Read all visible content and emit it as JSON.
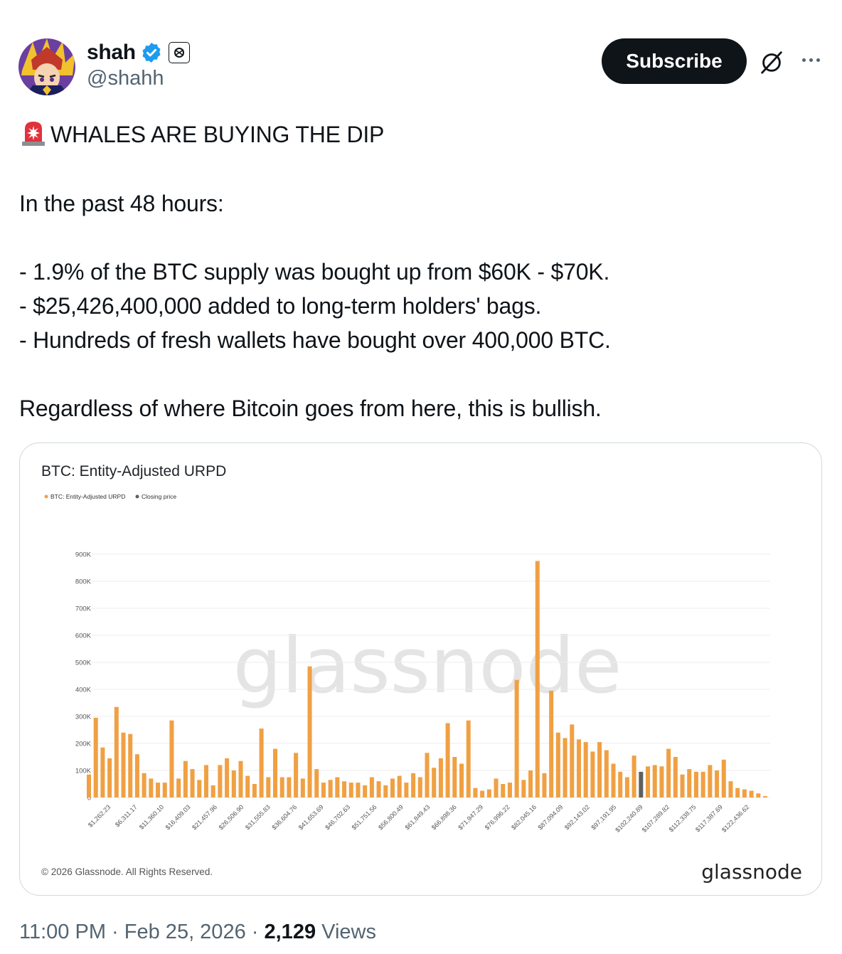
{
  "user": {
    "display_name": "shah",
    "handle": "@shahh"
  },
  "actions": {
    "subscribe_label": "Subscribe"
  },
  "post": {
    "headline": "WHALES ARE BUYING THE DIP",
    "intro": "In the past 48 hours:",
    "bullets": [
      "- 1.9% of the BTC supply was bought up from $60K - $70K.",
      "- $25,426,400,000 added to long-term holders' bags.",
      "- Hundreds of fresh wallets have bought over 400,000 BTC."
    ],
    "closing": "Regardless of where Bitcoin goes from here, this is bullish."
  },
  "meta": {
    "time": "11:00 PM",
    "date": "Feb 25, 2026",
    "views_count": "2,129",
    "views_label": "Views",
    "separator": "·"
  },
  "colors": {
    "bar": "#f0a043",
    "highlight_bar": "#5f5f5f",
    "closing_price_dot": "#5f5f5f",
    "accent_verified": "#1d9bf0"
  },
  "chart_data": {
    "type": "bar",
    "title": "BTC: Entity-Adjusted URPD",
    "legend": [
      {
        "name": "BTC: Entity-Adjusted URPD",
        "color": "#f0a043"
      },
      {
        "name": "Closing price",
        "color": "#5f5f5f"
      }
    ],
    "legend_position": "top-left",
    "watermark": "glassnode",
    "copyright": "© 2026 Glassnode. All Rights Reserved.",
    "brand": "glassnode",
    "grid": true,
    "ylim": [
      0,
      900000
    ],
    "y_ticks": [
      "0",
      "100K",
      "200K",
      "300K",
      "400K",
      "500K",
      "600K",
      "700K",
      "800K",
      "900K"
    ],
    "x_tick_labels": [
      "$1,262.23",
      "$6,311.17",
      "$11,360.10",
      "$16,409.03",
      "$21,457.96",
      "$26,506.90",
      "$31,555.83",
      "$36,604.76",
      "$41,653.69",
      "$46,702.63",
      "$51,751.56",
      "$56,800.49",
      "$61,849.43",
      "$66,898.36",
      "$71,947.29",
      "$76,996.22",
      "$82,045.16",
      "$87,094.09",
      "$92,143.02",
      "$97,191.95",
      "$102,240.89",
      "$107,289.82",
      "$112,338.75",
      "$117,387.69",
      "$122,436.62"
    ],
    "closing_price_bucket_index": 80,
    "values": [
      85000,
      295000,
      185000,
      145000,
      335000,
      240000,
      235000,
      160000,
      90000,
      70000,
      55000,
      55000,
      285000,
      70000,
      135000,
      105000,
      65000,
      120000,
      45000,
      120000,
      145000,
      100000,
      135000,
      80000,
      50000,
      255000,
      75000,
      180000,
      75000,
      75000,
      165000,
      70000,
      485000,
      105000,
      55000,
      65000,
      75000,
      60000,
      55000,
      55000,
      45000,
      75000,
      60000,
      45000,
      70000,
      80000,
      55000,
      90000,
      75000,
      165000,
      110000,
      145000,
      275000,
      150000,
      125000,
      285000,
      35000,
      25000,
      30000,
      70000,
      50000,
      55000,
      435000,
      65000,
      100000,
      875000,
      90000,
      395000,
      240000,
      220000,
      270000,
      215000,
      205000,
      170000,
      205000,
      175000,
      125000,
      95000,
      75000,
      155000,
      95000,
      115000,
      120000,
      115000,
      180000,
      150000,
      85000,
      105000,
      95000,
      95000,
      120000,
      100000,
      140000,
      60000,
      35000,
      30000,
      25000,
      15000,
      5000
    ]
  }
}
